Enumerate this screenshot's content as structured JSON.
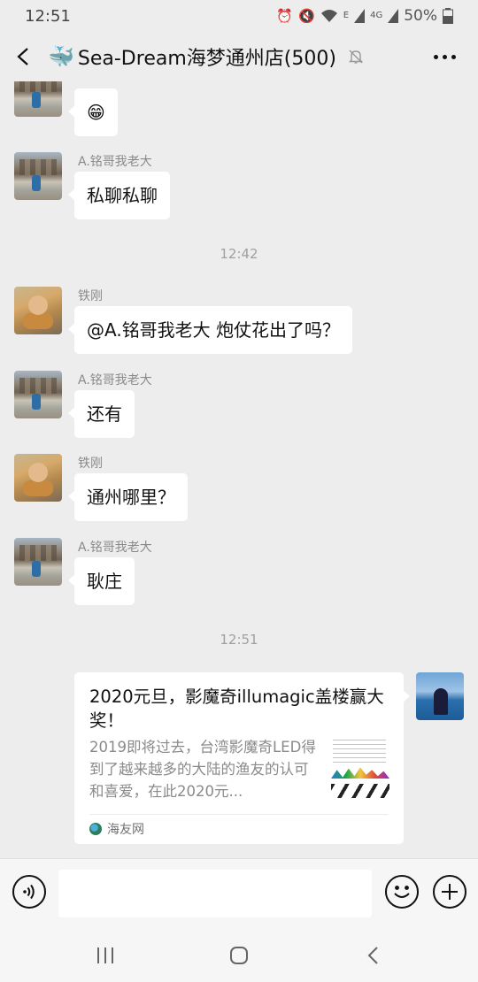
{
  "status_bar": {
    "time": "12:51",
    "network": "E",
    "network_alt": "4G",
    "battery": "50%"
  },
  "header": {
    "title": "Sea-Dream海梦通州店(500)",
    "title_icon": "whale-emoji"
  },
  "messages": [
    {
      "nick": "",
      "text": "😁"
    },
    {
      "nick": "A.铭哥我老大",
      "text": "私聊私聊"
    },
    {
      "nick": "铁刚",
      "text": "@A.铭哥我老大  炮仗花出了吗？"
    },
    {
      "nick": "A.铭哥我老大",
      "text": "还有"
    },
    {
      "nick": "铁刚",
      "text": "通州哪里？"
    },
    {
      "nick": "A.铭哥我老大",
      "text": "耿庄"
    }
  ],
  "timestamps": [
    "12:42",
    "12:51"
  ],
  "link_card": {
    "title": "2020元旦，影魔奇illumagic盖楼赢大奖！",
    "description": "2019即将过去，台湾影魔奇LED得到了越来越多的大陆的渔友的认可和喜爱，在此2020元...",
    "source": "海友网"
  },
  "input": {
    "placeholder": ""
  },
  "colors": {
    "background": "#ededed",
    "bubble": "#ffffff",
    "nick": "#8a8a8a"
  }
}
